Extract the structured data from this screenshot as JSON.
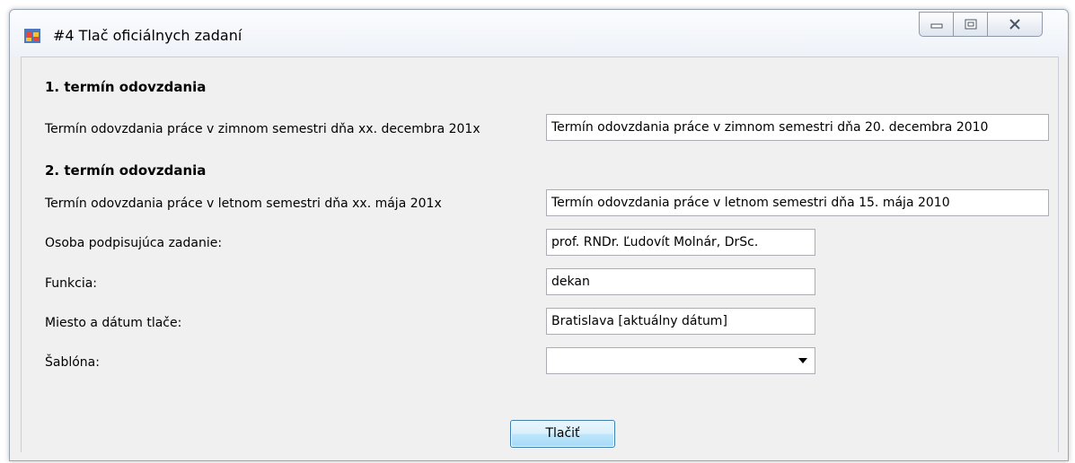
{
  "window": {
    "title": "#4 Tlač oficiálnych zadaní"
  },
  "section1": {
    "heading": "1. termín odovzdania",
    "label": "Termín odovzdania práce v zimnom semestri dňa xx. decembra 201x",
    "value": "Termín odovzdania práce v zimnom semestri dňa 20. decembra 2010"
  },
  "section2": {
    "heading": "2. termín odovzdania",
    "label": "Termín odovzdania práce v letnom semestri dňa xx. mája 201x",
    "value": "Termín odovzdania práce v letnom semestri dňa 15. mája 2010"
  },
  "signer": {
    "label": "Osoba podpisujúca zadanie:",
    "value": "prof. RNDr. Ľudovít Molnár, DrSc."
  },
  "function": {
    "label": "Funkcia:",
    "value": "dekan"
  },
  "place_date": {
    "label": "Miesto a dátum tlače:",
    "value": "Bratislava [aktuálny dátum]"
  },
  "template": {
    "label": "Šablóna:",
    "selected": ""
  },
  "actions": {
    "print_label": "Tlačiť"
  },
  "icons": {
    "app": "app-window-icon",
    "minimize": "minimize-icon",
    "maximize": "maximize-icon",
    "close": "close-icon",
    "dropdown": "chevron-down-icon"
  }
}
